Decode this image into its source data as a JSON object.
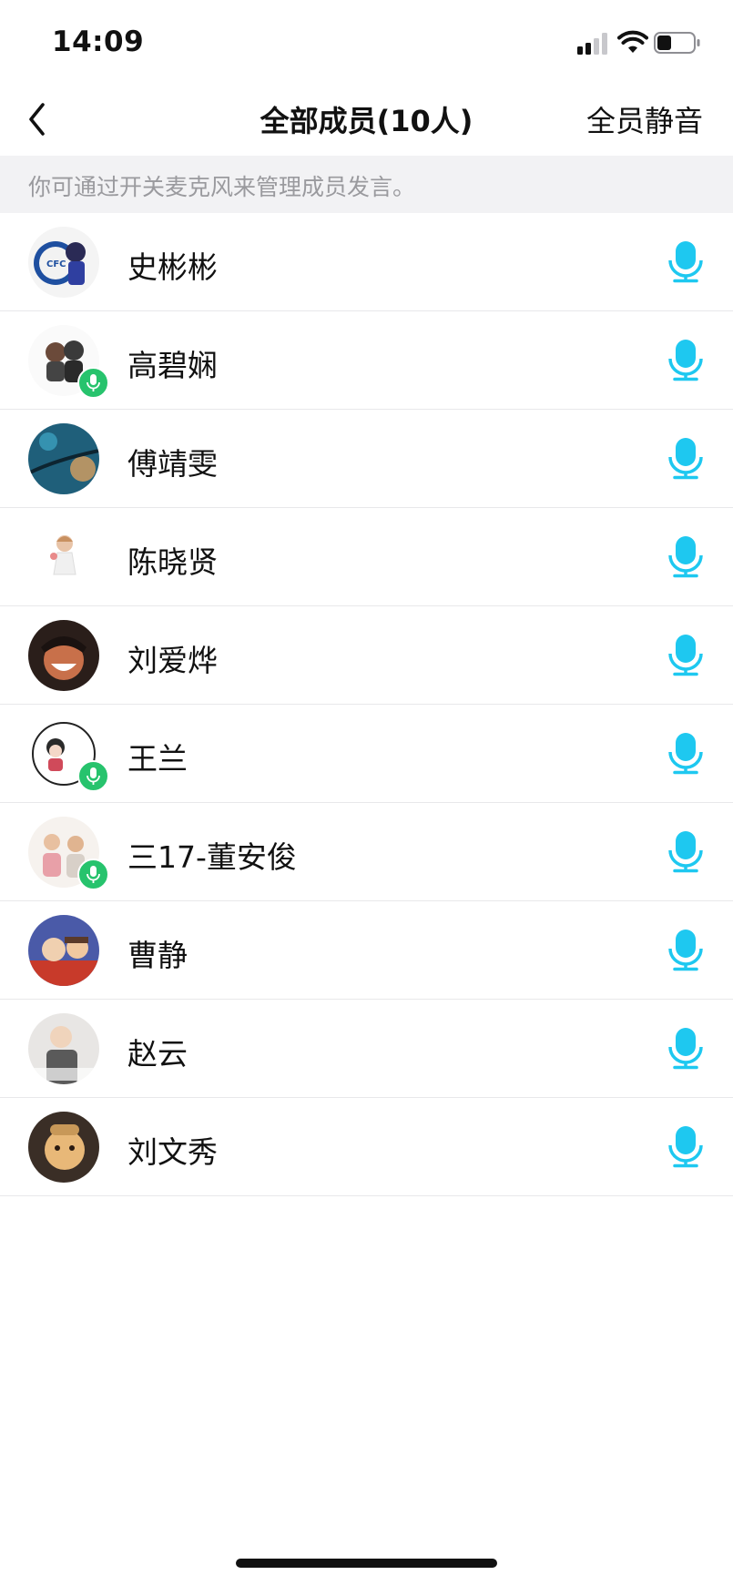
{
  "status_bar": {
    "time": "14:09",
    "signal_icon": "cellular-signal-icon",
    "wifi_icon": "wifi-icon",
    "battery_icon": "battery-icon"
  },
  "nav": {
    "back_icon": "chevron-left-icon",
    "title": "全部成员(10人)",
    "mute_all_label": "全员静音"
  },
  "hint": "你可通过开关麦克风来管理成员发言。",
  "colors": {
    "accent_mic": "#1ec8f0",
    "speaking_badge": "#27c36d",
    "hint_bg": "#f2f2f4",
    "hint_text": "#9a9a9e"
  },
  "members": [
    {
      "name": "史彬彬",
      "speaking": false,
      "mic_icon": "microphone-icon"
    },
    {
      "name": "高碧娴",
      "speaking": true,
      "mic_icon": "microphone-icon"
    },
    {
      "name": "傅靖雯",
      "speaking": false,
      "mic_icon": "microphone-icon"
    },
    {
      "name": "陈晓贤",
      "speaking": false,
      "mic_icon": "microphone-icon"
    },
    {
      "name": "刘爱烨",
      "speaking": false,
      "mic_icon": "microphone-icon"
    },
    {
      "name": "王兰",
      "speaking": true,
      "mic_icon": "microphone-icon"
    },
    {
      "name": "三17-董安俊",
      "speaking": true,
      "mic_icon": "microphone-icon"
    },
    {
      "name": "曹静",
      "speaking": false,
      "mic_icon": "microphone-icon"
    },
    {
      "name": "赵云",
      "speaking": false,
      "mic_icon": "microphone-icon"
    },
    {
      "name": "刘文秀",
      "speaking": false,
      "mic_icon": "microphone-icon"
    }
  ]
}
